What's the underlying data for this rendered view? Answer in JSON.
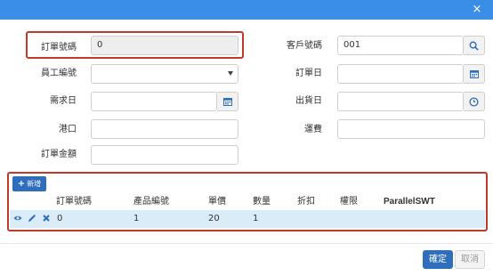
{
  "form": {
    "order_no_label": "訂單號碼",
    "order_no_value": "0",
    "customer_no_label": "客戶號碼",
    "customer_no_value": "001",
    "employee_no_label": "員工編號",
    "employee_no_value": "",
    "order_date_label": "訂單日",
    "order_date_value": "",
    "required_date_label": "需求日",
    "required_date_value": "",
    "shipped_date_label": "出貨日",
    "shipped_date_value": "",
    "port_label": "港口",
    "port_value": "",
    "freight_label": "運費",
    "freight_value": "",
    "amount_label": "訂單金額",
    "amount_value": ""
  },
  "detail": {
    "add_label": "新增",
    "columns": [
      "訂單號碼",
      "產品編號",
      "單價",
      "數量",
      "折扣",
      "權限",
      "ParallelSWT"
    ],
    "rows": [
      {
        "order_no": "0",
        "product_no": "1",
        "unit_price": "20",
        "quantity": "1",
        "discount": "",
        "permission": "",
        "parallel": ""
      }
    ]
  },
  "footer": {
    "ok_label": "確定",
    "cancel_label": "取消"
  },
  "colors": {
    "header_blue": "#3a8ee6",
    "primary_button": "#2f6ebd",
    "selected_row": "#d9ecf7",
    "highlight_box": "#c0392b"
  },
  "icons": {
    "close": "close-icon",
    "search": "search-icon",
    "calendar": "calendar-icon",
    "clock": "clock-icon",
    "view": "eye-icon",
    "edit": "pencil-icon",
    "delete": "x-icon",
    "add": "plus-icon"
  }
}
